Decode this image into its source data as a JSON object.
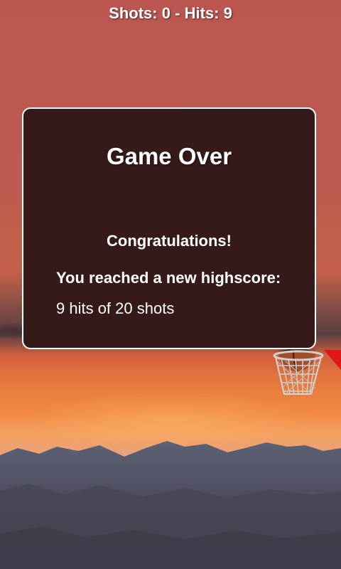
{
  "hud": {
    "shots_label": "Shots:",
    "shots_value": "0",
    "separator": "-",
    "hits_label": "Hits:",
    "hits_value": "9"
  },
  "dialog": {
    "title": "Game Over",
    "congrats": "Congratulations!",
    "highscore_text": "You reached a new highscore:",
    "result": "9 hits of 20 shots"
  },
  "colors": {
    "sky": "#bb5750",
    "dialog_bg": "#361a19",
    "dialog_border": "#ffffff",
    "text": "#ffffff"
  },
  "icons": {
    "basketball": "basketball-icon",
    "hoop": "basketball-hoop-icon"
  }
}
